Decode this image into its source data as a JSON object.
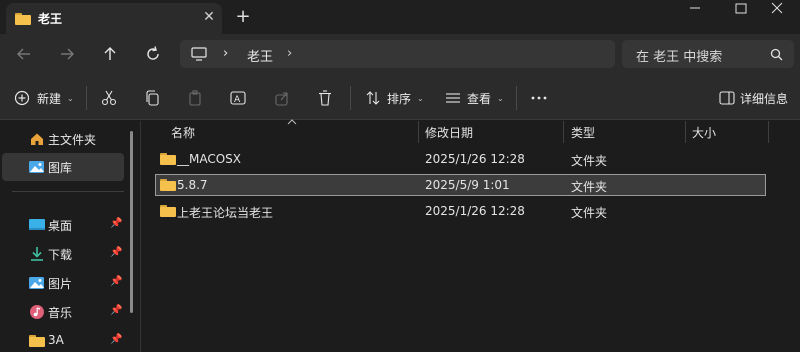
{
  "tab": {
    "title": "老王"
  },
  "address": {
    "breadcrumb": [
      "老王"
    ]
  },
  "search": {
    "placeholder": "在 老王 中搜索"
  },
  "toolbar": {
    "new_label": "新建",
    "sort_label": "排序",
    "view_label": "查看",
    "details_label": "详细信息"
  },
  "sidebar": {
    "items": [
      {
        "label": "主文件夹",
        "icon": "home-icon"
      },
      {
        "label": "图库",
        "icon": "gallery-icon"
      },
      {
        "label": "桌面",
        "icon": "desktop-icon"
      },
      {
        "label": "下载",
        "icon": "download-icon"
      },
      {
        "label": "图片",
        "icon": "pictures-icon"
      },
      {
        "label": "音乐",
        "icon": "music-icon"
      },
      {
        "label": "3A",
        "icon": "folder-icon"
      }
    ]
  },
  "columns": {
    "name": "名称",
    "date": "修改日期",
    "type": "类型",
    "size": "大小"
  },
  "files": [
    {
      "name": "__MACOSX",
      "date": "2025/1/26 12:28",
      "type": "文件夹",
      "size": ""
    },
    {
      "name": "5.8.7",
      "date": "2025/5/9 1:01",
      "type": "文件夹",
      "size": ""
    },
    {
      "name": "上老王论坛当老王",
      "date": "2025/1/26 12:28",
      "type": "文件夹",
      "size": ""
    }
  ],
  "colors": {
    "folder": "#f5c04c",
    "background": "#1c1c1c",
    "accent": "#4cc2ff"
  }
}
